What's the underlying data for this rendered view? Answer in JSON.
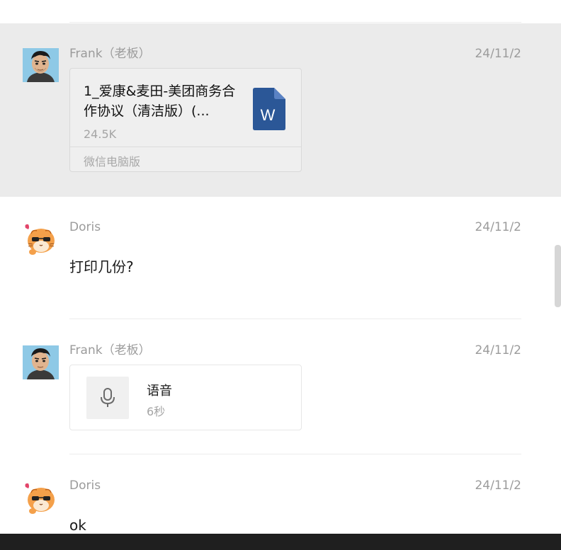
{
  "messages": [
    {
      "sender": "Frank（老板）",
      "time": "24/11/2",
      "file": {
        "name": "1_爱康&麦田-美团商务合作协议（清洁版）(...",
        "size": "24.5K",
        "source": "微信电脑版",
        "icon": "word-doc-icon",
        "icon_letter": "W"
      }
    },
    {
      "sender": "Doris",
      "time": "24/11/2",
      "text": "打印几份?"
    },
    {
      "sender": "Frank（老板）",
      "time": "24/11/2",
      "voice": {
        "label": "语音",
        "duration": "6秒",
        "icon": "microphone-icon"
      }
    },
    {
      "sender": "Doris",
      "time": "24/11/2",
      "text": "ok"
    }
  ],
  "colors": {
    "highlight_bg": "#ebebeb",
    "meta_text": "#9b9b9b",
    "word_blue": "#2b5797"
  }
}
